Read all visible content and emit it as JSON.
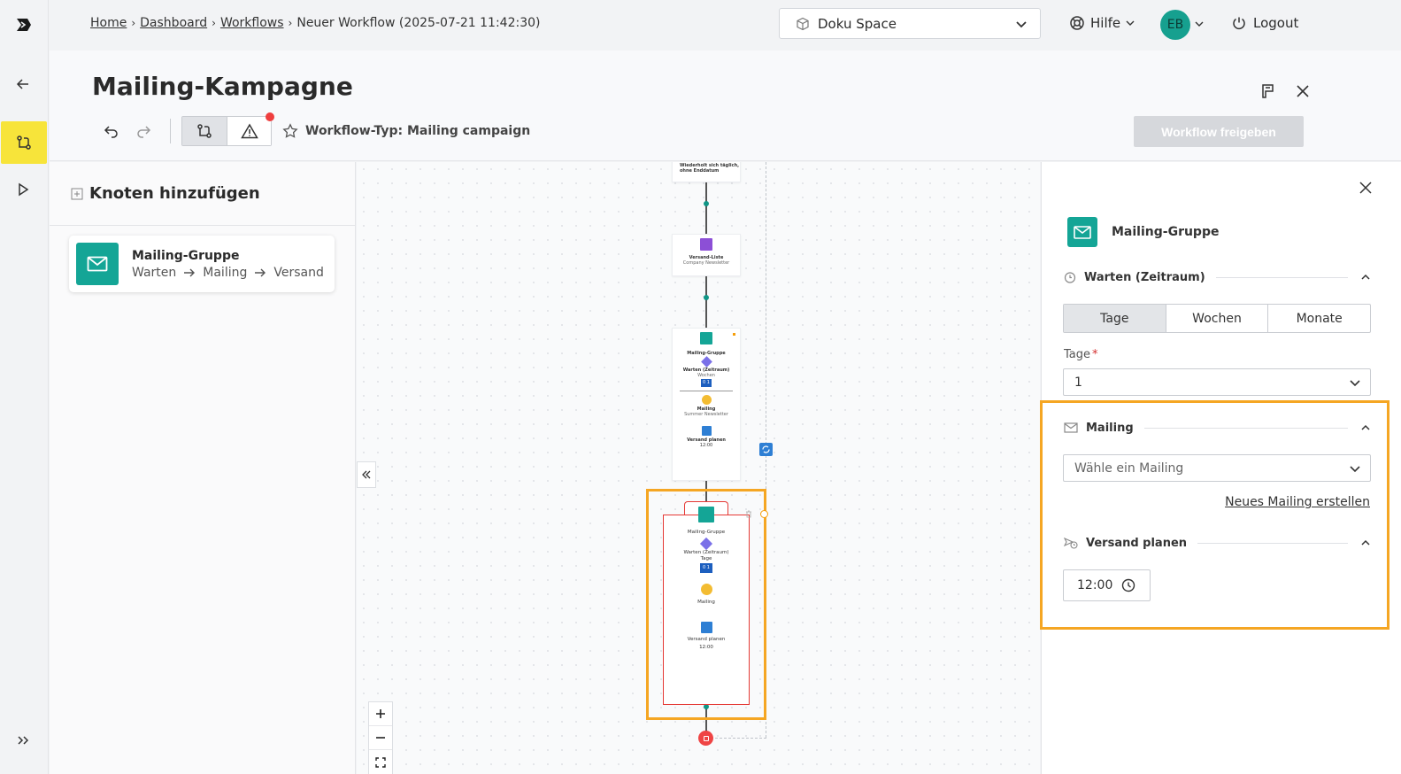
{
  "breadcrumb": {
    "items": [
      "Home",
      "Dashboard",
      "Workflows"
    ],
    "current": "Neuer Workflow (2025-07-21 11:42:30)"
  },
  "space_selector": {
    "value": "Doku Space"
  },
  "help": {
    "label": "Hilfe"
  },
  "user": {
    "initials": "EB"
  },
  "logout": {
    "label": "Logout"
  },
  "page": {
    "title": "Mailing-Kampagne",
    "workflow_type": "Workflow-Typ: Mailing campaign",
    "release_button": "Workflow freigeben"
  },
  "left_panel": {
    "title": "Knoten hinzufügen",
    "node": {
      "title": "Mailing-Gruppe",
      "steps": [
        "Warten",
        "Mailing",
        "Versand"
      ]
    }
  },
  "canvas": {
    "node_top": {
      "line1": "Wiederholt sich täglich,",
      "line2": "ohne Enddatum"
    },
    "node_list": {
      "title": "Versand-Liste",
      "sub": "Company Newsletter"
    },
    "node_group1": {
      "title": "Mailing-Gruppe",
      "wait": "Warten (Zeitraum)",
      "wait_unit": "Wochen",
      "wait_value": "0 1",
      "mailing": "Mailing",
      "mailing_name": "Summer Newsletter",
      "plan": "Versand planen",
      "plan_time": "12:00"
    },
    "node_group2": {
      "title": "Mailing-Gruppe",
      "wait": "Warten (Zeitraum)",
      "wait_unit": "Tage",
      "wait_value": "0 1",
      "mailing": "Mailing",
      "plan": "Versand planen",
      "plan_time": "12:00"
    },
    "zoom_in": "+",
    "zoom_out": "−"
  },
  "right_panel": {
    "node_title": "Mailing-Gruppe",
    "wait_section": "Warten (Zeitraum)",
    "units": [
      "Tage",
      "Wochen",
      "Monate"
    ],
    "selected_unit": "Tage",
    "days_label": "Tage",
    "days_required": "*",
    "days_value": "1",
    "mailing_section": "Mailing",
    "mailing_placeholder": "Wähle ein Mailing",
    "new_mailing_link": "Neues Mailing erstellen",
    "schedule_section": "Versand planen",
    "time_hh": "12",
    "time_mm": "00"
  },
  "colors": {
    "accent_yellow": "#f7e43a",
    "teal": "#14a596",
    "highlight_orange": "#f5a623",
    "alert_red": "#ef3e3e"
  }
}
